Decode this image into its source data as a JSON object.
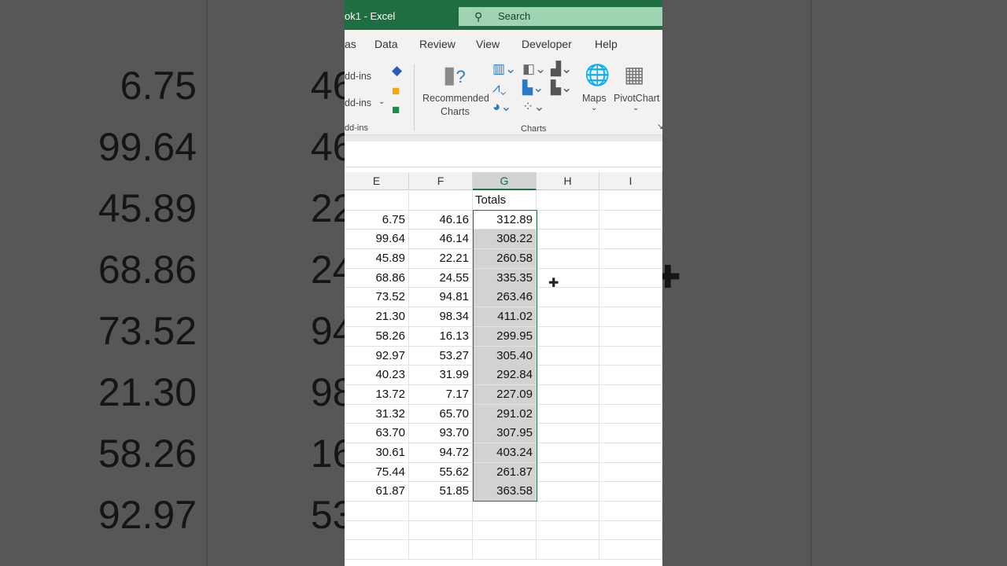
{
  "window": {
    "title": "ok1  -  Excel",
    "search_placeholder": "Search"
  },
  "tabs": [
    "as",
    "Data",
    "Review",
    "View",
    "Developer",
    "Help"
  ],
  "ribbon": {
    "addins1": "dd-ins",
    "addins2": "dd-ins",
    "addins_group": "dd-ins",
    "recommended": "Recommended",
    "charts_word": "Charts",
    "maps": "Maps",
    "pivotchart": "PivotChart",
    "charts_group": "Charts"
  },
  "columns": [
    "E",
    "F",
    "G",
    "H",
    "I"
  ],
  "header_row": {
    "G": "Totals"
  },
  "rows": [
    {
      "E": "6.75",
      "F": "46.16",
      "G": "312.89"
    },
    {
      "E": "99.64",
      "F": "46.14",
      "G": "308.22"
    },
    {
      "E": "45.89",
      "F": "22.21",
      "G": "260.58"
    },
    {
      "E": "68.86",
      "F": "24.55",
      "G": "335.35"
    },
    {
      "E": "73.52",
      "F": "94.81",
      "G": "263.46"
    },
    {
      "E": "21.30",
      "F": "98.34",
      "G": "411.02"
    },
    {
      "E": "58.26",
      "F": "16.13",
      "G": "299.95"
    },
    {
      "E": "92.97",
      "F": "53.27",
      "G": "305.40"
    },
    {
      "E": "40.23",
      "F": "31.99",
      "G": "292.84"
    },
    {
      "E": "13.72",
      "F": "7.17",
      "G": "227.09"
    },
    {
      "E": "31.32",
      "F": "65.70",
      "G": "291.02"
    },
    {
      "E": "63.70",
      "F": "93.70",
      "G": "307.95"
    },
    {
      "E": "30.61",
      "F": "94.72",
      "G": "403.24"
    },
    {
      "E": "75.44",
      "F": "55.62",
      "G": "261.87"
    },
    {
      "E": "61.87",
      "F": "51.85",
      "G": "363.58"
    }
  ],
  "colors": {
    "title_bar": "#1e6e42",
    "selection": "#217346"
  }
}
